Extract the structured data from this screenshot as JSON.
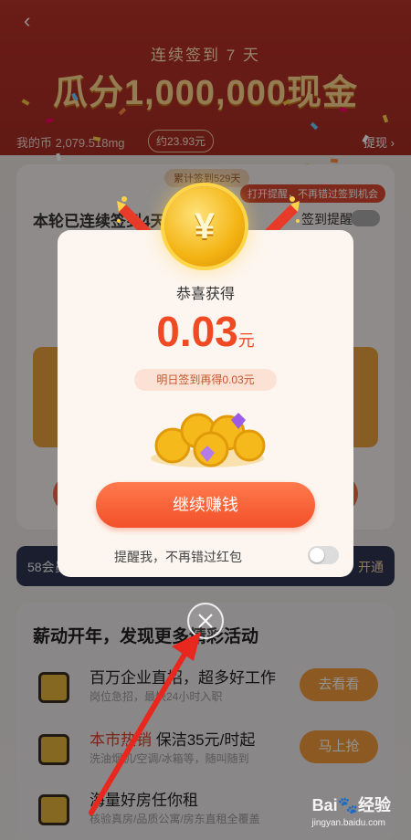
{
  "header": {
    "back_icon": "chevron-left-icon",
    "subtitle": "连续签到 7 天",
    "title": "瓜分1,000,000现金",
    "mine_text": "我的币 2,079.518mg",
    "mine_value": "约23.93元",
    "withdraw": "提现"
  },
  "sign_card": {
    "total_tag": "累计签到529天",
    "tip_tag": "打开提醒，不再错过签到机会",
    "title": "本轮已连续签到4天",
    "remind_label": "签到提醒"
  },
  "member_bar": {
    "left": "58会员",
    "right": "开通"
  },
  "activities": {
    "title": "薪动开年，发现更多精彩活动",
    "items": [
      {
        "title": "百万企业直招，超多好工作",
        "subtitle": "岗位急招，最快24小时入职",
        "button": "去看看"
      },
      {
        "title_hl": "本市热销",
        "title_rest": " 保洁35元/时起",
        "subtitle": "洗油烟机/空调/冰箱等，随叫随到",
        "button": "马上抢"
      },
      {
        "title": "海量好房任你租",
        "subtitle": "核验真房/品质公寓/房东直租全覆盖",
        "button": ""
      }
    ]
  },
  "popup": {
    "coin_symbol": "¥",
    "congrats": "恭喜获得",
    "amount": "0.03",
    "unit": "元",
    "tomorrow_text": "明日签到再得0.03元",
    "cta_label": "继续赚钱",
    "remind_text": "提醒我，不再错过红包",
    "remind_enabled": false
  },
  "watermark": {
    "brand": "Bai🐾经验",
    "url": "jingyan.baidu.com"
  },
  "colors": {
    "accent": "#f04a24",
    "hero_bg": "#b83228",
    "cta": "#f2502a"
  }
}
